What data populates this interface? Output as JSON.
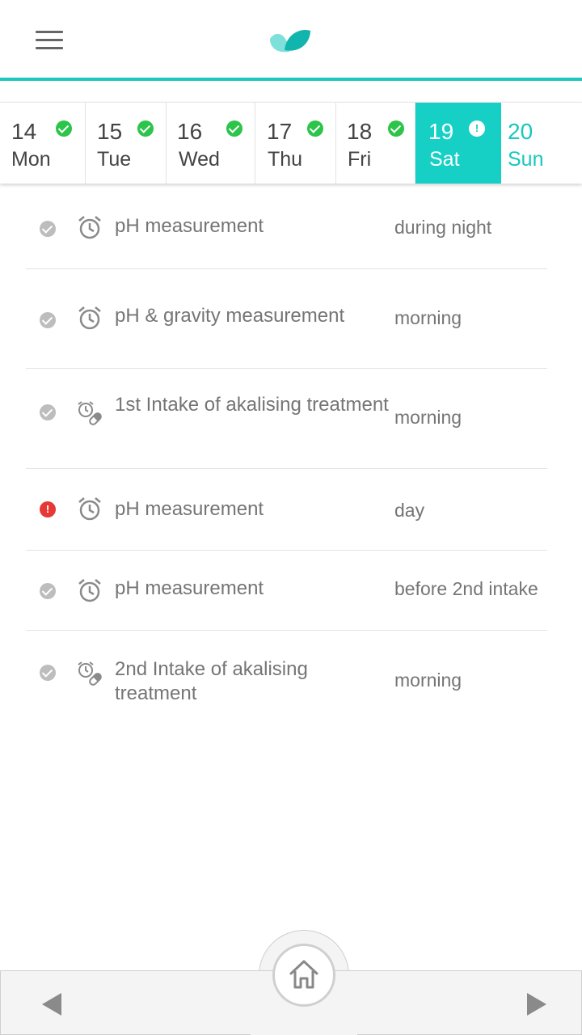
{
  "header": {
    "menu_icon": "hamburger-menu-icon",
    "logo_icon": "leaf-logo-icon",
    "accent_color": "#1cc8c0"
  },
  "days": [
    {
      "num": "14",
      "name": "Mon",
      "status": "done"
    },
    {
      "num": "15",
      "name": "Tue",
      "status": "done"
    },
    {
      "num": "16",
      "name": "Wed",
      "status": "done"
    },
    {
      "num": "17",
      "name": "Thu",
      "status": "done"
    },
    {
      "num": "18",
      "name": "Fri",
      "status": "done"
    },
    {
      "num": "19",
      "name": "Sat",
      "status": "warning",
      "selected": true
    },
    {
      "num": "20",
      "name": "Sun",
      "status": "none"
    }
  ],
  "tasks": [
    {
      "state": "done",
      "icon": "alarm-icon",
      "title": "pH measurement",
      "when": "during night"
    },
    {
      "state": "done",
      "icon": "alarm-icon",
      "title": "pH & gravity measurement",
      "when": "morning"
    },
    {
      "state": "done",
      "icon": "alarm-pill-icon",
      "title": "1st Intake of akalising treatment",
      "when": "morning"
    },
    {
      "state": "alert",
      "icon": "alarm-icon",
      "title": "pH measurement",
      "when": "day"
    },
    {
      "state": "done",
      "icon": "alarm-icon",
      "title": "pH measurement",
      "when": "before 2nd intake"
    },
    {
      "state": "done",
      "icon": "alarm-pill-icon",
      "title": "2nd Intake of akalising treatment",
      "when": "morning"
    }
  ],
  "bottom": {
    "prev_icon": "triangle-left-icon",
    "home_icon": "home-icon",
    "next_icon": "triangle-right-icon"
  },
  "colors": {
    "accent": "#16d0c6",
    "success": "#2cc44a",
    "alert": "#e53935",
    "done_grey": "#bdbdbd"
  }
}
